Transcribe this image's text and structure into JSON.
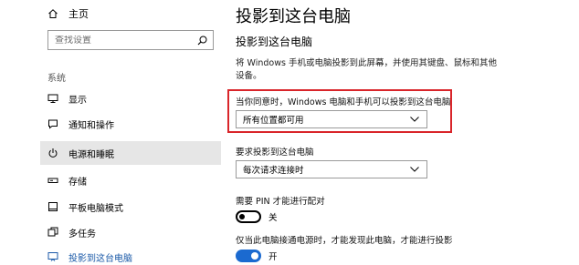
{
  "sidebar": {
    "home_label": "主页",
    "search_placeholder": "查找设置",
    "section_label": "系统",
    "items": [
      {
        "label": "显示",
        "icon": "monitor-icon"
      },
      {
        "label": "通知和操作",
        "icon": "notification-icon"
      },
      {
        "label": "电源和睡眠",
        "icon": "power-icon"
      },
      {
        "label": "存储",
        "icon": "storage-drive-icon"
      },
      {
        "label": "平板电脑模式",
        "icon": "tablet-mode-icon"
      },
      {
        "label": "多任务",
        "icon": "multitasking-icon"
      },
      {
        "label": "投影到这台电脑",
        "icon": "project-icon"
      }
    ]
  },
  "main": {
    "page_title": "投影到这台电脑",
    "section_title": "投影到这台电脑",
    "description": "将 Windows 手机或电脑投影到此屏幕，并使用其键盘、鼠标和其他设备。",
    "availability_label": "当你同意时，Windows 电脑和手机可以投影到这台电脑",
    "availability_value": "所有位置都可用",
    "request_label": "要求投影到这台电脑",
    "request_value": "每次请求连接时",
    "pin_label": "需要 PIN 才能进行配对",
    "pin_state": "关",
    "power_label": "仅当此电脑接通电源时，才能发现此电脑，才能进行投影",
    "power_state": "开"
  },
  "colors": {
    "accent": "#1b6ad0",
    "highlight_border": "#d9252a",
    "hover_bg": "#e6e6e6"
  }
}
